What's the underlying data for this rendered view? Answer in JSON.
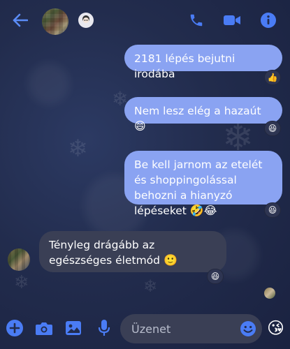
{
  "colors": {
    "accent": "#4a7cf5",
    "outgoing_bubble": "#8aa3f2",
    "incoming_bubble": "#3a3f55",
    "background": "#222c4d"
  },
  "header": {
    "icons": [
      "back-arrow-icon",
      "phone-icon",
      "video-camera-icon",
      "info-icon"
    ]
  },
  "messages": [
    {
      "direction": "outgoing",
      "text": "2181 lépés bejutni irodába",
      "reaction": "👍"
    },
    {
      "direction": "outgoing",
      "text": "Nem lesz elég a hazaút",
      "trailing_emoji": "😄",
      "reaction": "😆"
    },
    {
      "direction": "outgoing",
      "text": "Be kell jarnom az etelét és shoppingolással behozni a hianyzó lépéseket",
      "trailing_emoji": "🤣😂",
      "reaction": "😆"
    },
    {
      "direction": "incoming",
      "text": "Tényleg drágább az egészséges életmód",
      "trailing_emoji": "🙂",
      "reaction": "😆"
    }
  ],
  "composer": {
    "placeholder": "Üzenet",
    "icons": [
      "plus-icon",
      "camera-icon",
      "image-icon",
      "microphone-icon",
      "emoji-icon",
      "sticker-icon"
    ],
    "sticker": "😘"
  }
}
